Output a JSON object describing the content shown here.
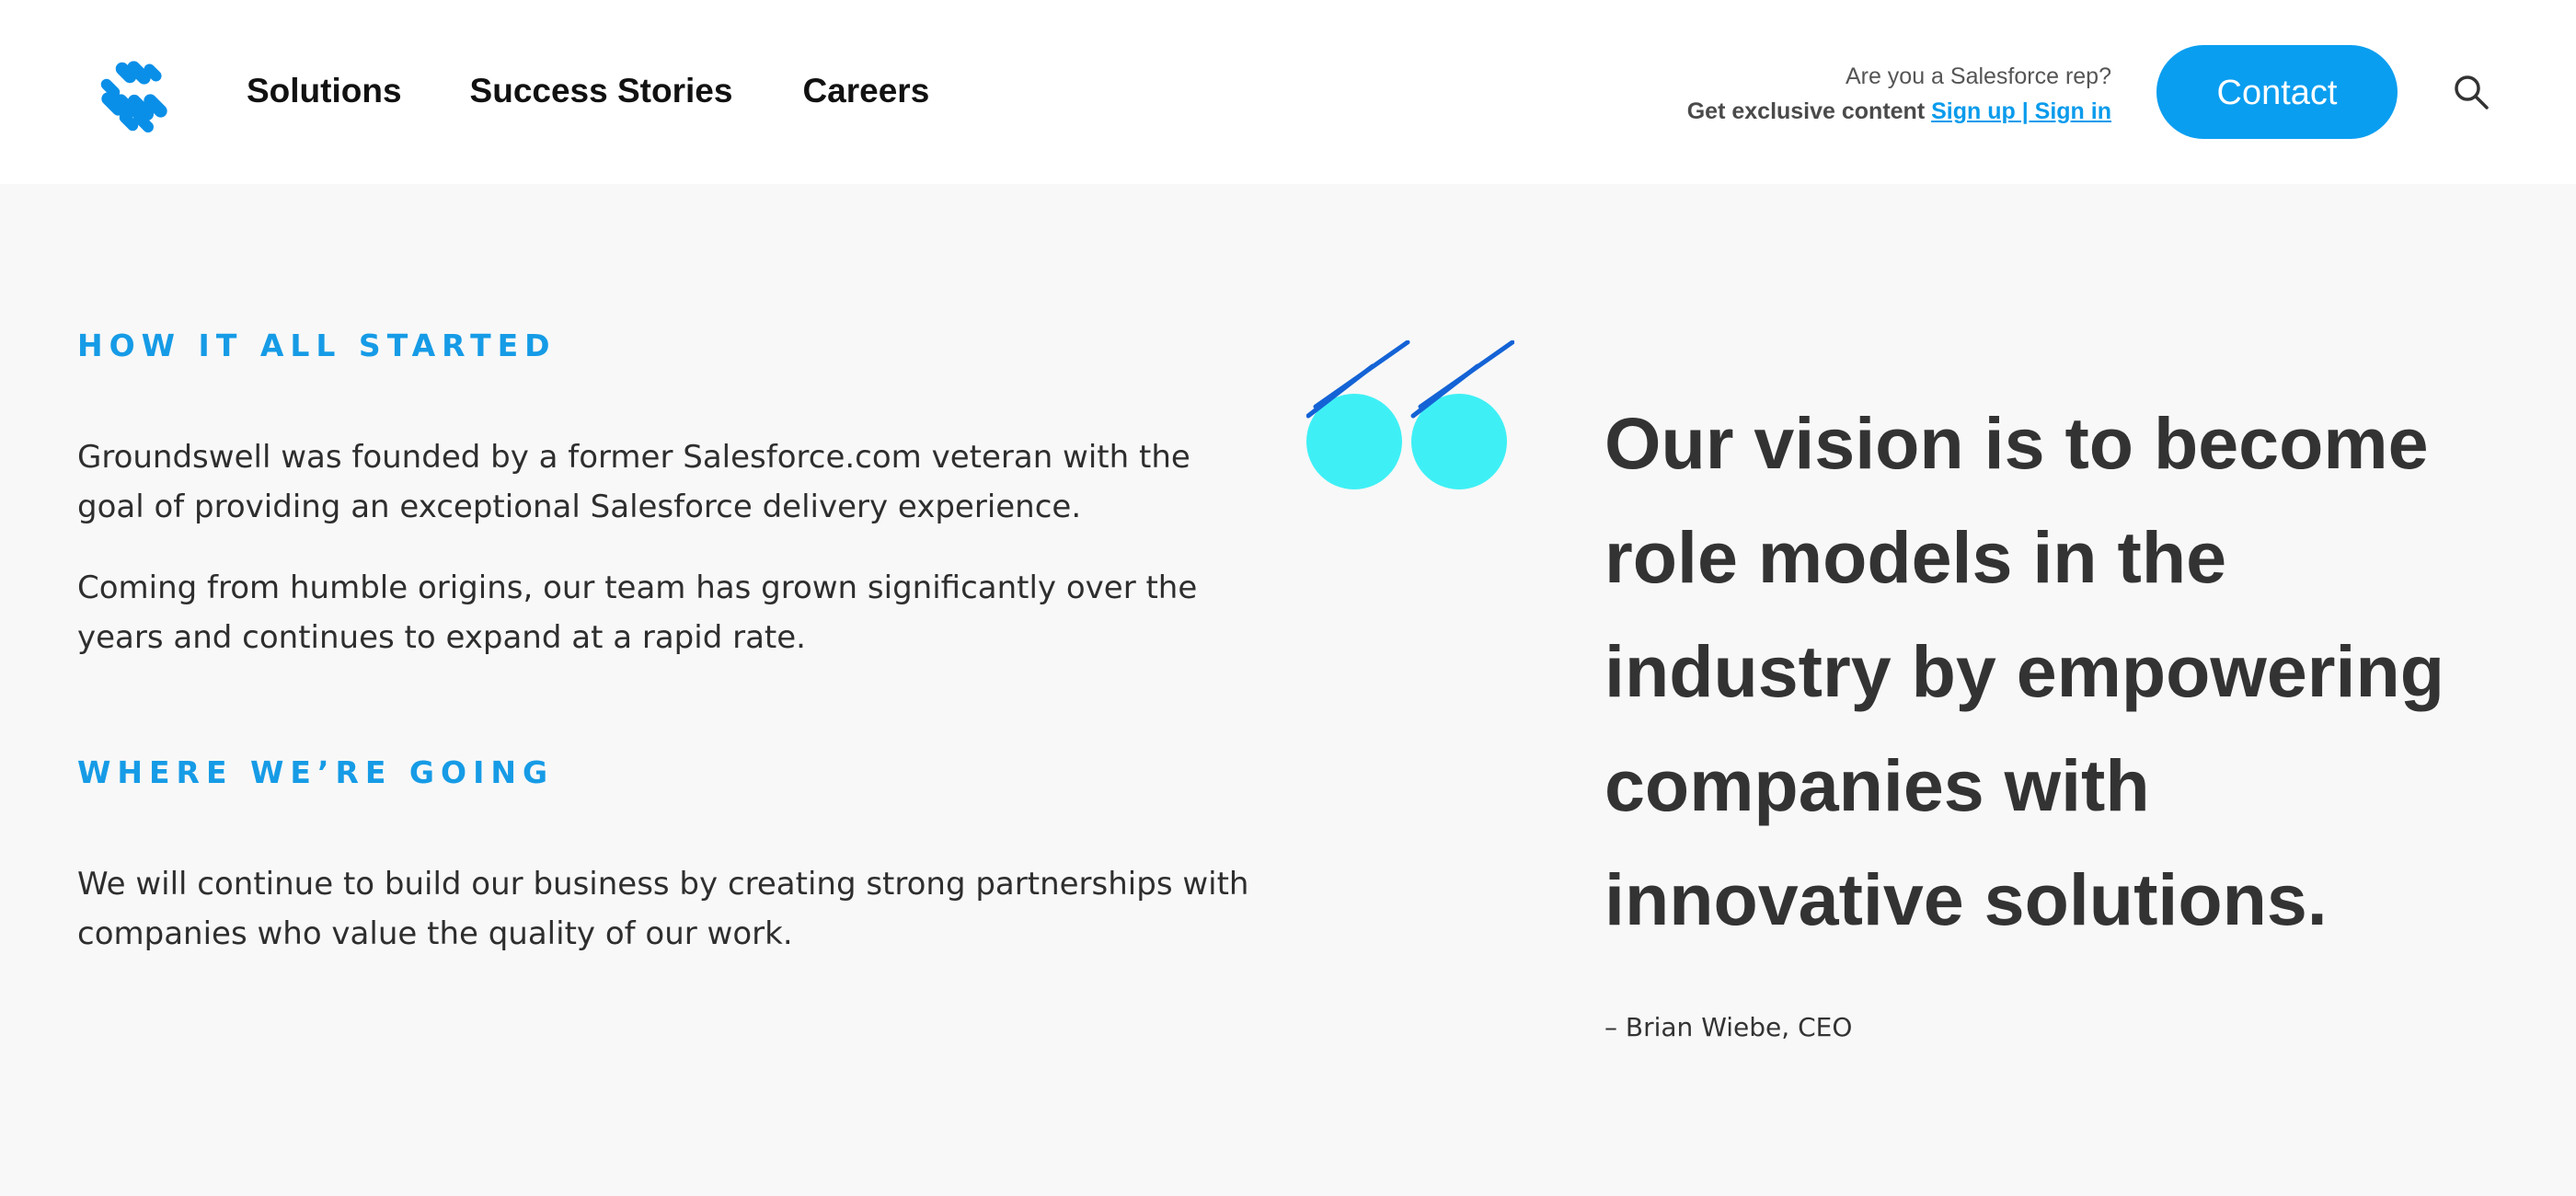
{
  "header": {
    "nav": [
      {
        "label": "Solutions"
      },
      {
        "label": "Success Stories"
      },
      {
        "label": "Careers"
      }
    ],
    "rep_prompt": "Are you a Salesforce rep?",
    "rep_cta_text": "Get exclusive content",
    "rep_link": "Sign up | Sign in",
    "contact_label": "Contact"
  },
  "story": {
    "started_heading": "HOW IT ALL STARTED",
    "started_para1": "Groundswell was founded by a former Salesforce.com veteran with the goal of providing an exceptional Salesforce delivery experience.",
    "started_para2": "Coming from humble origins, our team has grown significantly over the years and continues to expand at a rapid rate.",
    "going_heading": "WHERE WE’RE GOING",
    "going_para": "We will continue to build our business by creating strong partnerships with companies who value the quality of our work."
  },
  "quote": {
    "text": "Our vision is to become role models in the industry by empowering companies with innovative solutions.",
    "attribution": "– Brian Wiebe, CEO"
  },
  "colors": {
    "brand_blue": "#0a9ef0",
    "quote_cyan": "#3ef0f5",
    "quote_stroke": "#1463d6"
  },
  "icons": [
    "groundswell-logo",
    "search-icon",
    "quote-mark-icon"
  ]
}
